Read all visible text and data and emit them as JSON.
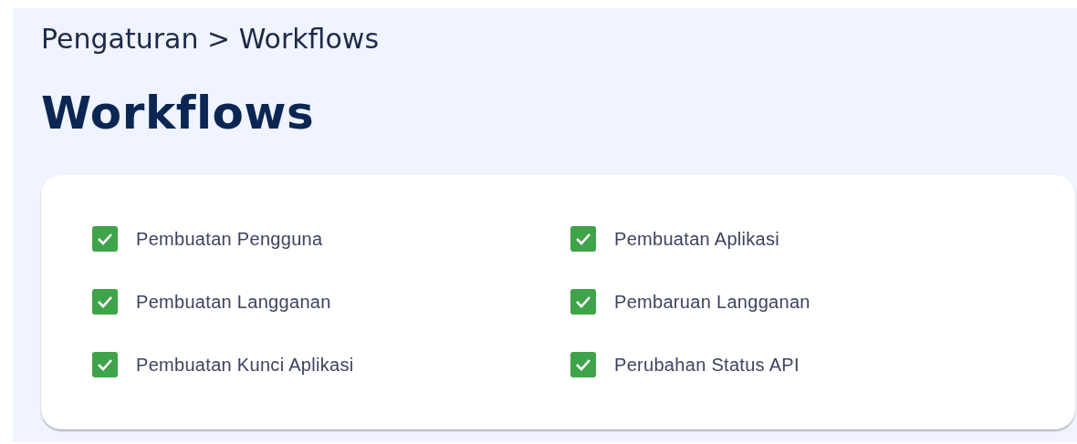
{
  "breadcrumb": "Pengaturan > Workflows",
  "title": "Workflows",
  "workflows": [
    {
      "label": "Pembuatan Pengguna",
      "checked": true
    },
    {
      "label": "Pembuatan Aplikasi",
      "checked": true
    },
    {
      "label": "Pembuatan Langganan",
      "checked": true
    },
    {
      "label": "Pembaruan Langganan",
      "checked": true
    },
    {
      "label": "Pembuatan Kunci Aplikasi",
      "checked": true
    },
    {
      "label": "Perubahan Status API",
      "checked": true
    }
  ]
}
